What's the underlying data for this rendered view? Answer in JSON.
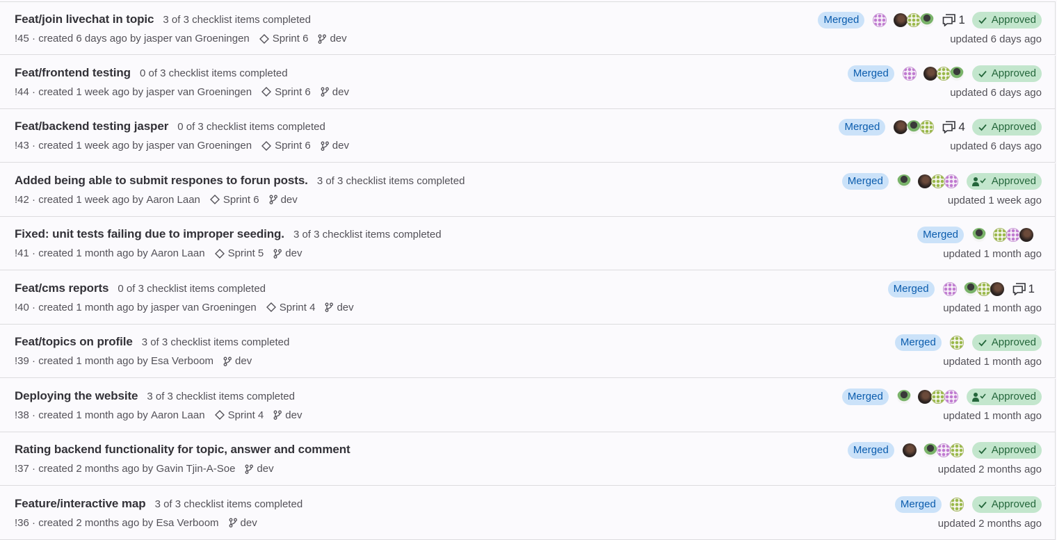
{
  "merge_requests": [
    {
      "title": "Feat/join livechat in topic",
      "checklist": "3 of 3 checklist items completed",
      "ref": "!45",
      "created": "created 6 days ago by",
      "author": "jasper van Groeningen",
      "milestone": "Sprint 6",
      "branch": "dev",
      "status": "Merged",
      "approval": "Approved",
      "approval_icon": "check-icon",
      "comments": "1",
      "updated": "updated 6 days ago",
      "avatars": [
        "p",
        "|",
        "d",
        "g",
        "gr"
      ]
    },
    {
      "title": "Feat/frontend testing",
      "checklist": "0 of 3 checklist items completed",
      "ref": "!44",
      "created": "created 1 week ago by",
      "author": "jasper van Groeningen",
      "milestone": "Sprint 6",
      "branch": "dev",
      "status": "Merged",
      "approval": "Approved",
      "approval_icon": "check-icon",
      "comments": "",
      "updated": "updated 6 days ago",
      "avatars": [
        "p",
        "|",
        "d",
        "g",
        "gr"
      ]
    },
    {
      "title": "Feat/backend testing jasper",
      "checklist": "0 of 3 checklist items completed",
      "ref": "!43",
      "created": "created 1 week ago by",
      "author": "jasper van Groeningen",
      "milestone": "Sprint 6",
      "branch": "dev",
      "status": "Merged",
      "approval": "Approved",
      "approval_icon": "check-icon",
      "comments": "4",
      "updated": "updated 6 days ago",
      "avatars": [
        "d",
        "gr",
        "g"
      ]
    },
    {
      "title": "Added being able to submit respones to forun posts.",
      "checklist": "3 of 3 checklist items completed",
      "ref": "!42",
      "created": "created 1 week ago by",
      "author": "Aaron Laan",
      "milestone": "Sprint 6",
      "branch": "dev",
      "status": "Merged",
      "approval": "Approved",
      "approval_icon": "user-check-icon",
      "comments": "",
      "updated": "updated 1 week ago",
      "avatars": [
        "gr",
        "|",
        "d",
        "g",
        "p"
      ]
    },
    {
      "title": "Fixed: unit tests failing due to improper seeding.",
      "checklist": "3 of 3 checklist items completed",
      "ref": "!41",
      "created": "created 1 month ago by",
      "author": "Aaron Laan",
      "milestone": "Sprint 5",
      "branch": "dev",
      "status": "Merged",
      "approval": "",
      "approval_icon": "",
      "comments": "",
      "updated": "updated 1 month ago",
      "avatars": [
        "gr",
        "|",
        "g",
        "p",
        "d"
      ]
    },
    {
      "title": "Feat/cms reports",
      "checklist": "0 of 3 checklist items completed",
      "ref": "!40",
      "created": "created 1 month ago by",
      "author": "jasper van Groeningen",
      "milestone": "Sprint 4",
      "branch": "dev",
      "status": "Merged",
      "approval": "",
      "approval_icon": "",
      "comments": "1",
      "updated": "updated 1 month ago",
      "avatars": [
        "p",
        "|",
        "gr",
        "g",
        "d"
      ]
    },
    {
      "title": "Feat/topics on profile",
      "checklist": "3 of 3 checklist items completed",
      "ref": "!39",
      "created": "created 1 month ago by",
      "author": "Esa Verboom",
      "milestone": "",
      "branch": "dev",
      "status": "Merged",
      "approval": "Approved",
      "approval_icon": "check-icon",
      "comments": "",
      "updated": "updated 1 month ago",
      "avatars": [
        "g"
      ]
    },
    {
      "title": "Deploying the website",
      "checklist": "3 of 3 checklist items completed",
      "ref": "!38",
      "created": "created 1 month ago by",
      "author": "Aaron Laan",
      "milestone": "Sprint 4",
      "branch": "dev",
      "status": "Merged",
      "approval": "Approved",
      "approval_icon": "user-check-icon",
      "comments": "",
      "updated": "updated 1 month ago",
      "avatars": [
        "gr",
        "|",
        "d",
        "g",
        "p"
      ]
    },
    {
      "title": "Rating backend functionality for topic, answer and comment",
      "checklist": "",
      "ref": "!37",
      "created": "created 2 months ago by",
      "author": "Gavin Tjin-A-Soe",
      "milestone": "",
      "branch": "dev",
      "status": "Merged",
      "approval": "Approved",
      "approval_icon": "check-icon",
      "comments": "",
      "updated": "updated 2 months ago",
      "avatars": [
        "d",
        "|",
        "gr",
        "p",
        "g"
      ]
    },
    {
      "title": "Feature/interactive map",
      "checklist": "3 of 3 checklist items completed",
      "ref": "!36",
      "created": "created 2 months ago by",
      "author": "Esa Verboom",
      "milestone": "",
      "branch": "dev",
      "status": "Merged",
      "approval": "Approved",
      "approval_icon": "check-icon",
      "comments": "",
      "updated": "updated 2 months ago",
      "avatars": [
        "g"
      ]
    }
  ],
  "colors": {
    "merged_bg": "#cbe2f9",
    "merged_text": "#0b5cad",
    "approved_bg": "#c3e6cd",
    "approved_text": "#24663b"
  }
}
